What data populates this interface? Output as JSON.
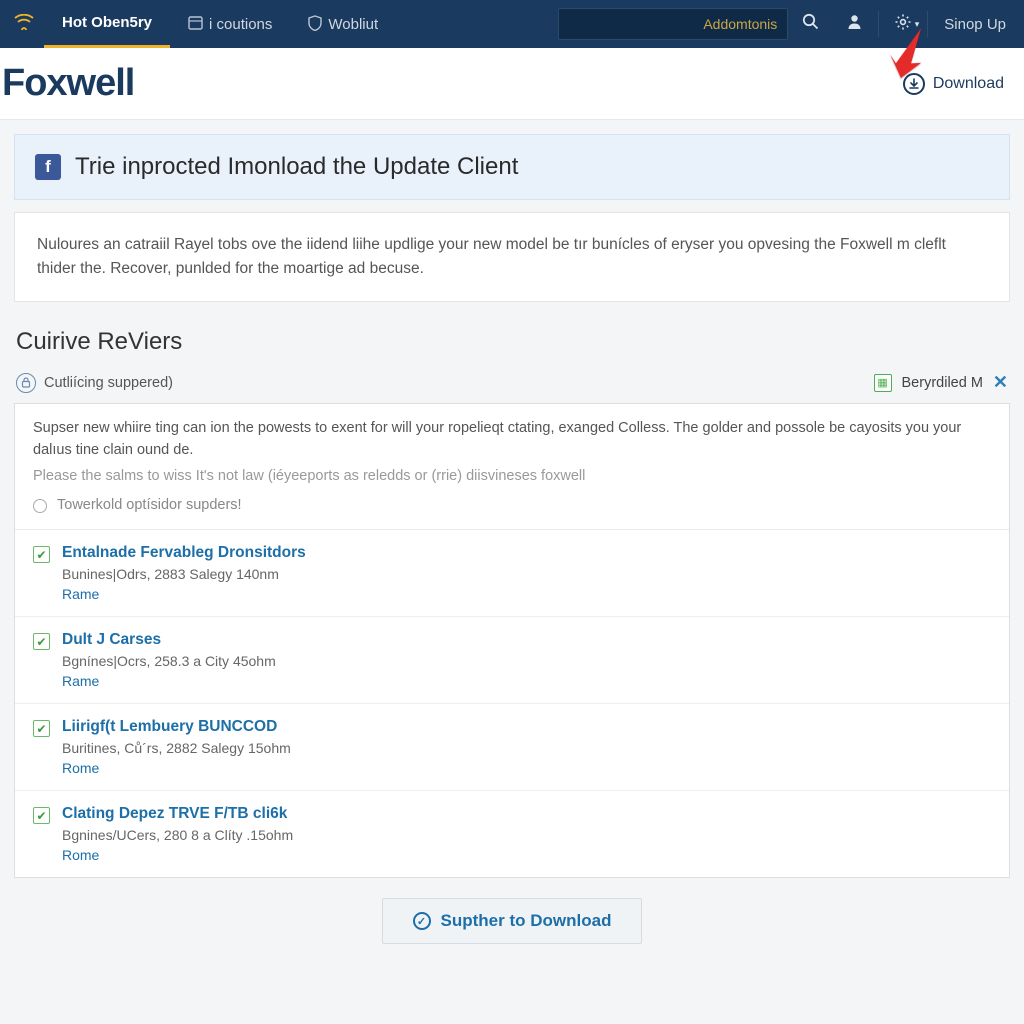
{
  "topnav": {
    "items": [
      {
        "label": "Hot Oben5ry"
      },
      {
        "label": "i coutions"
      },
      {
        "label": "Wobliut"
      }
    ],
    "search_placeholder": "Addomtonis",
    "right_label": "Sinop Up"
  },
  "brand": "Foxwell",
  "download_label": "Download",
  "banner": {
    "title": "Trie inprocted Imonload the Update Client"
  },
  "intro": "Nuloures an catraiil Rayel tobs ove the iidend liihe updlige your new model be tır bunícles of eryser you opvesing the Foxwell m cleflt thider the. Recover, punlded for the moartige ad becuse.",
  "section_title": "Cuirive ReViers",
  "filter": {
    "left": "Cutliícing suppered)",
    "right": "Beryrdiled M"
  },
  "panel_head": {
    "line1": "Supser new whiire ting can ion the powests to exent for will your ropelieqt ctating, exanged Colless. The golder and possole be cayosits you your dalıus tine clain ound de.",
    "line2": "Please the salms to wiss It's not law (iéyeeports as reledds or (rrie) diisvineses foxwell",
    "opt": "Towerkold optísidor supders!"
  },
  "items": [
    {
      "title": "Entalnade Fervableg Dronsitdors",
      "meta": "Bunines|Odrs, 2883 Salegy 140nm",
      "action": "Rame"
    },
    {
      "title": "Dult J Carses",
      "meta": "Bgnínes|Ocrs, 258.3 a City 45ohm",
      "action": "Rame"
    },
    {
      "title": "Liirigf(t Lembuery BUNCCOD",
      "meta": "Buritines, Ců´rs, 2882 Salegy 15ohm",
      "action": "Rome"
    },
    {
      "title": "Clating Depez TRVE F/TB cli6k",
      "meta": "Bgnines/UCers, 280 8 a Clíty .15ohm",
      "action": "Rome"
    }
  ],
  "footer_btn": "Supther to Download"
}
